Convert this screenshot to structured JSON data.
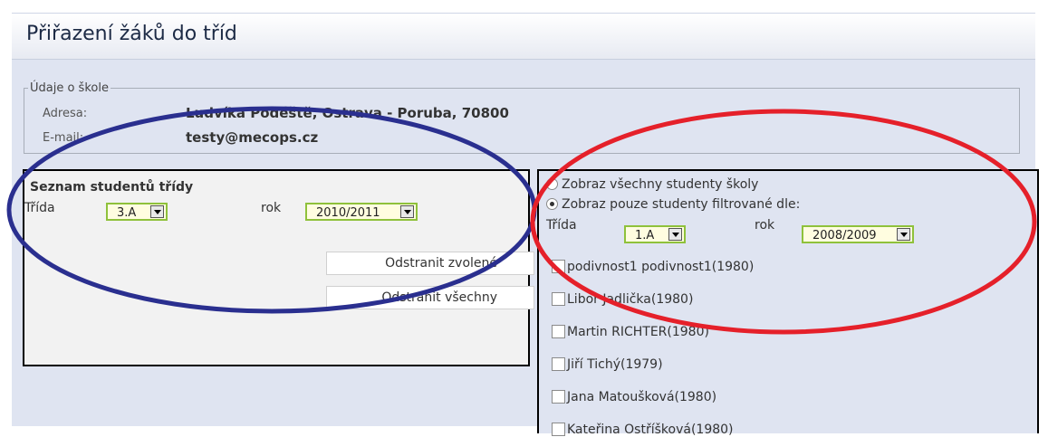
{
  "header": {
    "title": "Přiřazení žáků do tříd"
  },
  "school": {
    "legend": "Údaje o škole",
    "address_label": "Adresa:",
    "address_value": "Ludvíka Podéště, Ostrava - Poruba, 70800",
    "email_label": "E-mail:",
    "email_value": "testy@mecops.cz"
  },
  "class_list": {
    "title": "Seznam studentů třídy",
    "class_label": "Třída",
    "class_value": "3.A",
    "year_label": "rok",
    "year_value": "2010/2011",
    "remove_selected": "Odstranit zvolené",
    "remove_all": "Odstranit všechny"
  },
  "filter": {
    "show_all": "Zobraz všechny studenty školy",
    "show_filtered": "Zobraz pouze studenty filtrované dle:",
    "selected_option": "show_filtered",
    "class_label": "Třída",
    "class_value": "1.A",
    "year_label": "rok",
    "year_value": "2008/2009"
  },
  "students": [
    "podivnost1 podivnost1(1980)",
    "Libor Jadlička(1980)",
    "Martin RICHTER(1980)",
    "Jiří Tichý(1979)",
    "Jana Matoušková(1980)",
    "Kateřina Ostříšková(1980)"
  ],
  "annotation_colors": {
    "left_ellipse": "#2a2f8f",
    "right_ellipse": "#e5202a"
  }
}
